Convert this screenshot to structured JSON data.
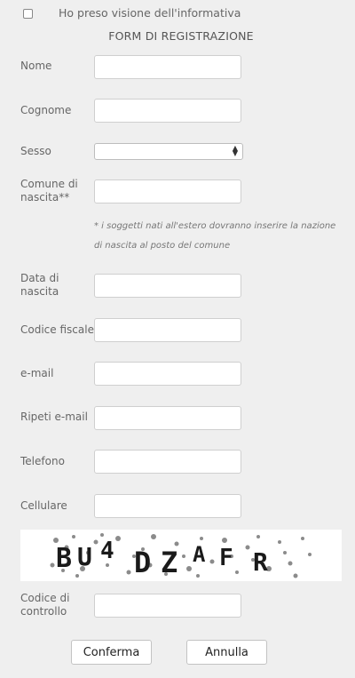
{
  "consent": {
    "label": "Ho preso visione dell'informativa",
    "checked": false
  },
  "form_title": "FORM DI REGISTRAZIONE",
  "fields": {
    "nome": {
      "label": "Nome",
      "value": ""
    },
    "cognome": {
      "label": "Cognome",
      "value": ""
    },
    "sesso": {
      "label": "Sesso",
      "selected": ""
    },
    "comune": {
      "label_line1": "Comune di",
      "label_line2": "nascita**",
      "value": ""
    },
    "note": "* i soggetti nati all'estero dovranno inserire la nazione di nascita al posto del comune",
    "data_nascita": {
      "label_line1": "Data di",
      "label_line2": "nascita",
      "value": ""
    },
    "codice_fiscale": {
      "label": "Codice fiscale",
      "value": ""
    },
    "email": {
      "label": "e-mail",
      "value": ""
    },
    "ripeti_email": {
      "label": "Ripeti e-mail",
      "value": ""
    },
    "telefono": {
      "label": "Telefono",
      "value": ""
    },
    "cellulare": {
      "label": "Cellulare",
      "value": ""
    },
    "codice_controllo": {
      "label_line1": "Codice di",
      "label_line2": "controllo",
      "value": ""
    }
  },
  "captcha": {
    "text": "BU4DZAFR"
  },
  "buttons": {
    "confirm": "Conferma",
    "cancel": "Annulla"
  },
  "colors": {
    "background": "#efefef",
    "input_border": "#cfcfcf"
  }
}
